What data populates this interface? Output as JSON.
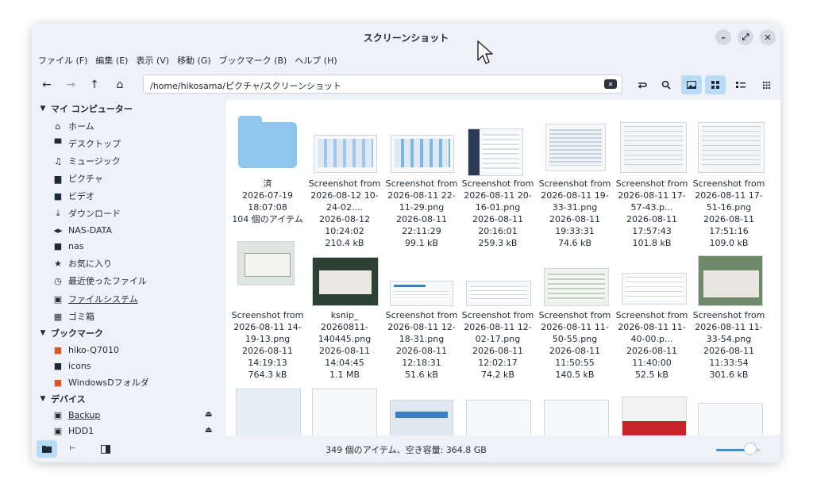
{
  "window": {
    "title": "スクリーンショット"
  },
  "window_buttons": [
    "–",
    "⤢",
    "✕"
  ],
  "menu": [
    "ファイル (F)",
    "編集 (E)",
    "表示 (V)",
    "移動 (G)",
    "ブックマーク (B)",
    "ヘルプ (H)"
  ],
  "toolbar": {
    "back": "←",
    "forward": "→",
    "up": "↑",
    "home": "⌂",
    "path": "/home/hikosama/ピクチャ/スクリーンショット",
    "clear": "✕"
  },
  "sidebar": {
    "my_computer": "マイ コンピューター",
    "places": [
      {
        "label": "ホーム",
        "icon": "home-icon"
      },
      {
        "label": "デスクトップ",
        "icon": "desktop-icon"
      },
      {
        "label": "ミュージック",
        "icon": "music-icon"
      },
      {
        "label": "ピクチャ",
        "icon": "picture-icon"
      },
      {
        "label": "ビデオ",
        "icon": "video-icon"
      },
      {
        "label": "ダウンロード",
        "icon": "download-icon"
      },
      {
        "label": "NAS-DATA",
        "icon": "network-drive-icon"
      },
      {
        "label": "nas",
        "icon": "folder-icon"
      },
      {
        "label": "お気に入り",
        "icon": "star-icon"
      },
      {
        "label": "最近使ったファイル",
        "icon": "clock-icon"
      },
      {
        "label": "ファイルシステム",
        "icon": "drive-icon"
      },
      {
        "label": "ゴミ箱",
        "icon": "trash-icon"
      }
    ],
    "bookmarks_header": "ブックマーク",
    "bookmarks": [
      {
        "label": "hiko-Q7010",
        "icon": "bookmark-folder-icon"
      },
      {
        "label": "icons",
        "icon": "folder-icon"
      },
      {
        "label": "WindowsDフォルダ",
        "icon": "bookmark-folder-icon"
      }
    ],
    "devices_header": "デバイス",
    "devices": [
      {
        "label": "Backup",
        "icon": "drive-icon"
      },
      {
        "label": "HDD1",
        "icon": "drive-icon"
      }
    ]
  },
  "files_row1": [
    {
      "name": "済",
      "date": "2026-07-19",
      "time": "18:07:08",
      "size": "104 個のアイテム"
    },
    {
      "name": "Screenshot from 2026-08-12 10-24-02....",
      "date": "2026-08-12",
      "time": "10:24:02",
      "size": "210.4 kB"
    },
    {
      "name": "Screenshot from 2026-08-11 22-11-29.png",
      "date": "2026-08-11",
      "time": "22:11:29",
      "size": "99.1 kB"
    },
    {
      "name": "Screenshot from 2026-08-11 20-16-01.png",
      "date": "2026-08-11",
      "time": "20:16:01",
      "size": "259.3 kB"
    },
    {
      "name": "Screenshot from 2026-08-11 19-33-31.png",
      "date": "2026-08-11",
      "time": "19:33:31",
      "size": "74.6 kB"
    },
    {
      "name": "Screenshot from 2026-08-11 17-57-43.p...",
      "date": "2026-08-11",
      "time": "17:57:43",
      "size": "101.8 kB"
    },
    {
      "name": "Screenshot from 2026-08-11 17-51-16.png",
      "date": "2026-08-11",
      "time": "17:51:16",
      "size": "109.0 kB"
    }
  ],
  "files_row2": [
    {
      "name": "Screenshot from 2026-08-11 14-19-13.png",
      "date": "2026-08-11",
      "time": "14:19:13",
      "size": "764.3 kB"
    },
    {
      "name": "ksnip_ 20260811- 140445.png",
      "date": "2026-08-11",
      "time": "14:04:45",
      "size": "1.1 MB"
    },
    {
      "name": "Screenshot from 2026-08-11 12-18-31.png",
      "date": "2026-08-11",
      "time": "12:18:31",
      "size": "51.6 kB"
    },
    {
      "name": "Screenshot from 2026-08-11 12-02-17.png",
      "date": "2026-08-11",
      "time": "12:02:17",
      "size": "74.2 kB"
    },
    {
      "name": "Screenshot from 2026-08-11 11-50-55.png",
      "date": "2026-08-11",
      "time": "11:50:55",
      "size": "140.5 kB"
    },
    {
      "name": "Screenshot from 2026-08-11 11-40-00.p...",
      "date": "2026-08-11",
      "time": "11:40:00",
      "size": "52.5 kB"
    },
    {
      "name": "Screenshot from 2026-08-11 11-33-54.png",
      "date": "2026-08-11",
      "time": "11:33:54",
      "size": "301.6 kB"
    }
  ],
  "status": {
    "text": "349 個のアイテム、空き容量: 364.8 GB",
    "zoom": 0.78
  }
}
